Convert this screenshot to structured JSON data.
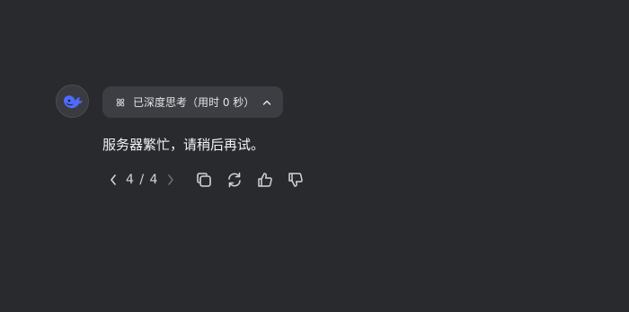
{
  "assistant": {
    "avatar_icon": "deepseek-whale-icon",
    "accent_color": "#4d6bfe"
  },
  "thinking": {
    "icon": "atom-icon",
    "label": "已深度思考（用时 0 秒）",
    "toggle_icon": "chevron-up-icon"
  },
  "message": {
    "text": "服务器繁忙，请稍后再试。"
  },
  "pager": {
    "prev_icon": "chevron-left-icon",
    "count": "4 / 4",
    "next_icon": "chevron-right-icon"
  },
  "toolbar": {
    "icons": [
      "copy-icon",
      "regenerate-icon",
      "thumbs-up-icon",
      "thumbs-down-icon"
    ]
  }
}
